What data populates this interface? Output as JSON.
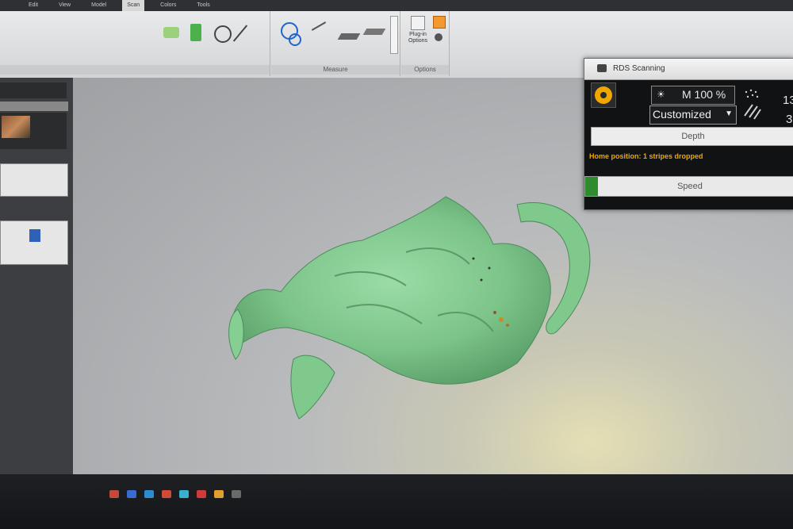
{
  "ribbon": {
    "tabs": [
      "Edit",
      "View",
      "Model",
      "Scan",
      "Colors",
      "Tools"
    ],
    "active_tab_index": 3,
    "groups": {
      "measure_label": "Measure",
      "options_label": "Options",
      "plugin_options_label": "Plug-in\nOptions"
    }
  },
  "viewport": {
    "tabs": [
      "",
      "",
      ""
    ]
  },
  "scan_dialog": {
    "title": "RDS Scanning",
    "brightness_value": "M 100 %",
    "preset_select": "Customized",
    "right_value_top": "13",
    "right_value_bottom": "3",
    "depth_label": "Depth",
    "status_message": "Home position: 1 stripes dropped",
    "speed_label": "Speed",
    "speed_progress": 0.06
  },
  "colors": {
    "accent_orange": "#f0a800",
    "speed_green": "#2e8b2e",
    "mesh_green": "#7fc98c"
  }
}
